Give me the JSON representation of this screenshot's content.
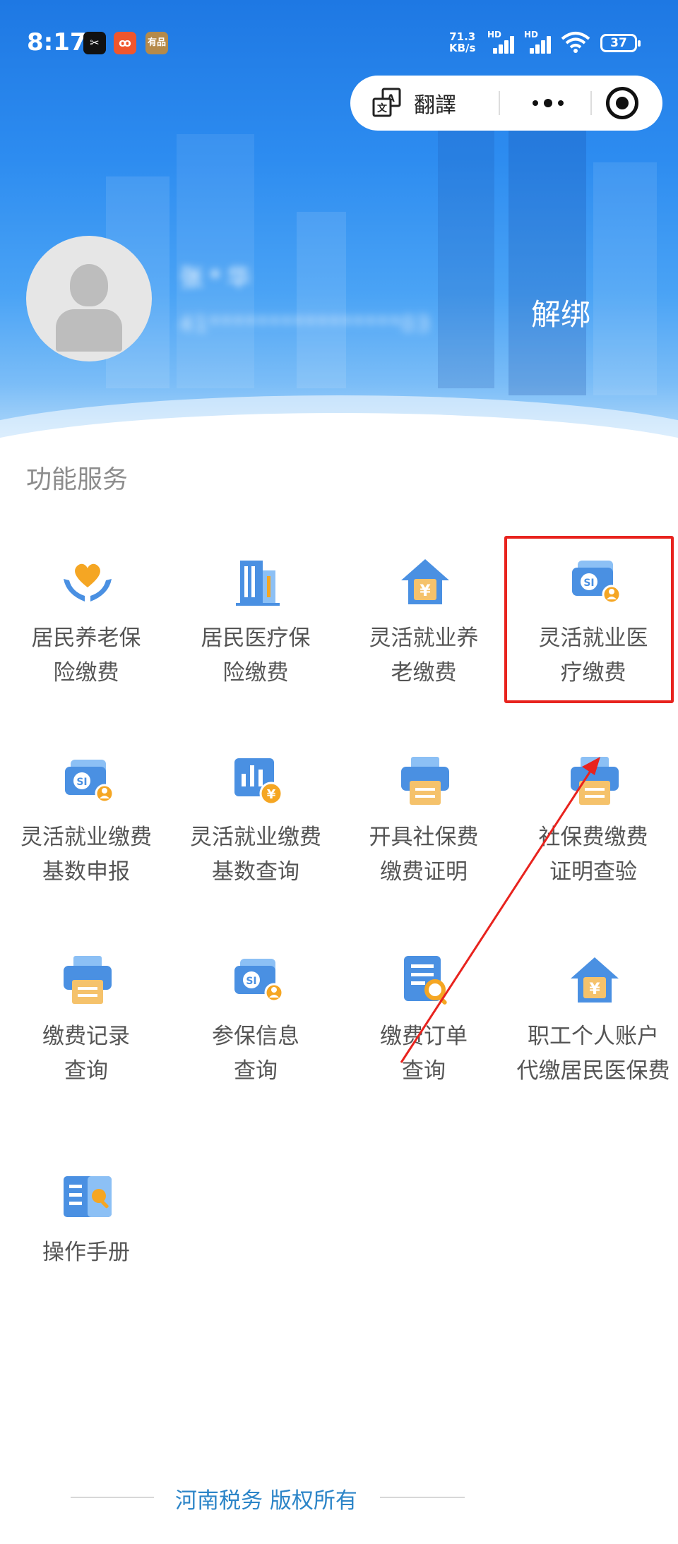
{
  "status_bar": {
    "time": "8:17",
    "apps": [
      "capcut-icon",
      "kuaishou-icon",
      "youpin-icon"
    ],
    "youpin_label": "有品",
    "net_speed": "71.3",
    "net_unit": "KB/s",
    "hd_1": "HD",
    "hd_2": "HD",
    "battery": "37"
  },
  "capsule": {
    "translate_label": "翻譯"
  },
  "profile": {
    "name": "张*华",
    "id_masked": "41****************03",
    "unbind_label": "解绑"
  },
  "section_title": "功能服务",
  "services": [
    {
      "label": "居民养老保\n险缴费",
      "icon": "heart-hands-icon"
    },
    {
      "label": "居民医疗保\n险缴费",
      "icon": "building-icon"
    },
    {
      "label": "灵活就业养\n老缴费",
      "icon": "house-yuan-icon"
    },
    {
      "label": "灵活就业医\n疗缴费",
      "icon": "social-security-card-icon"
    },
    {
      "label": "灵活就业缴费\n基数申报",
      "icon": "social-security-card-icon"
    },
    {
      "label": "灵活就业缴费\n基数查询",
      "icon": "chart-yuan-icon"
    },
    {
      "label": "开具社保费\n缴费证明",
      "icon": "printer-icon"
    },
    {
      "label": "社保费缴费\n证明查验",
      "icon": "printer-icon"
    },
    {
      "label": "缴费记录\n查询",
      "icon": "printer-icon"
    },
    {
      "label": "参保信息\n查询",
      "icon": "social-security-card-icon"
    },
    {
      "label": "缴费订单\n查询",
      "icon": "document-search-icon"
    },
    {
      "label": "职工个人账户\n代缴居民医保费",
      "icon": "house-yuan-icon"
    },
    {
      "label": "操作手册",
      "icon": "manual-book-icon"
    }
  ],
  "footer_text": "河南税务 版权所有",
  "colors": {
    "header_blue": "#2d8cf0",
    "highlight_red": "#e8231e",
    "icon_blue": "#4a90e2",
    "icon_orange": "#f5a623",
    "footer_text": "#2c85c8"
  }
}
